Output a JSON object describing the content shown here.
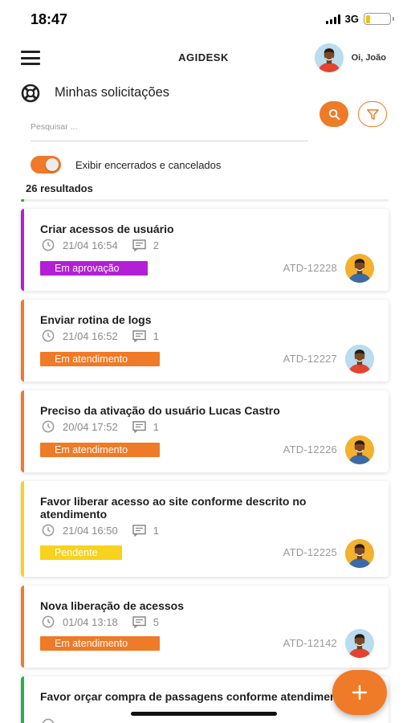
{
  "status_bar": {
    "time": "18:47",
    "network": "3G",
    "battery_level": 0.18
  },
  "header": {
    "title": "AGIDESK",
    "greeting": "Oi, João"
  },
  "page": {
    "title": "Minhas solicitações",
    "search_placeholder": "Pesquisar ...",
    "toggle_label": "Exibir encerrados e cancelados",
    "toggle_on": true,
    "results_label": "26 resultados"
  },
  "colors": {
    "accent": "#ef7a27",
    "approval": "#b31fd6",
    "in_progress": "#ef7a27",
    "pending": "#f7d21e",
    "done": "#27b04b"
  },
  "icons": {
    "menu": "menu-icon",
    "search": "search-icon",
    "filter": "filter-icon",
    "lifebuoy": "lifebuoy-icon",
    "clock": "clock-icon",
    "comment": "comment-icon",
    "add": "plus-icon"
  },
  "tickets": [
    {
      "title": "Criar acessos de usuário",
      "datetime": "21/04 16:54",
      "comments": "2",
      "status": "Em aprovação",
      "code": "ATD-12228",
      "color": "#b31fd6",
      "avatar": "warm"
    },
    {
      "title": "Enviar rotina de logs",
      "datetime": "21/04 16:52",
      "comments": "1",
      "status": "Em atendimento",
      "code": "ATD-12227",
      "color": "#ef7a27",
      "avatar": "blue"
    },
    {
      "title": "Preciso da ativação do usuário Lucas Castro",
      "datetime": "20/04 17:52",
      "comments": "1",
      "status": "Em atendimento",
      "code": "ATD-12226",
      "color": "#ef7a27",
      "avatar": "warm"
    },
    {
      "title": "Favor liberar acesso ao site conforme descrito no atendimento",
      "datetime": "21/04 16:50",
      "comments": "1",
      "status": "Pendente",
      "code": "ATD-12225",
      "color": "#f7d21e",
      "avatar": "warm"
    },
    {
      "title": "Nova liberação de acessos",
      "datetime": "01/04 13:18",
      "comments": "5",
      "status": "Em atendimento",
      "code": "ATD-12142",
      "color": "#ef7a27",
      "avatar": "blue"
    },
    {
      "title": "Favor orçar compra de passagens conforme atendimento",
      "datetime": "",
      "comments": "",
      "status": "",
      "code": "",
      "color": "#27b04b",
      "avatar": ""
    }
  ]
}
